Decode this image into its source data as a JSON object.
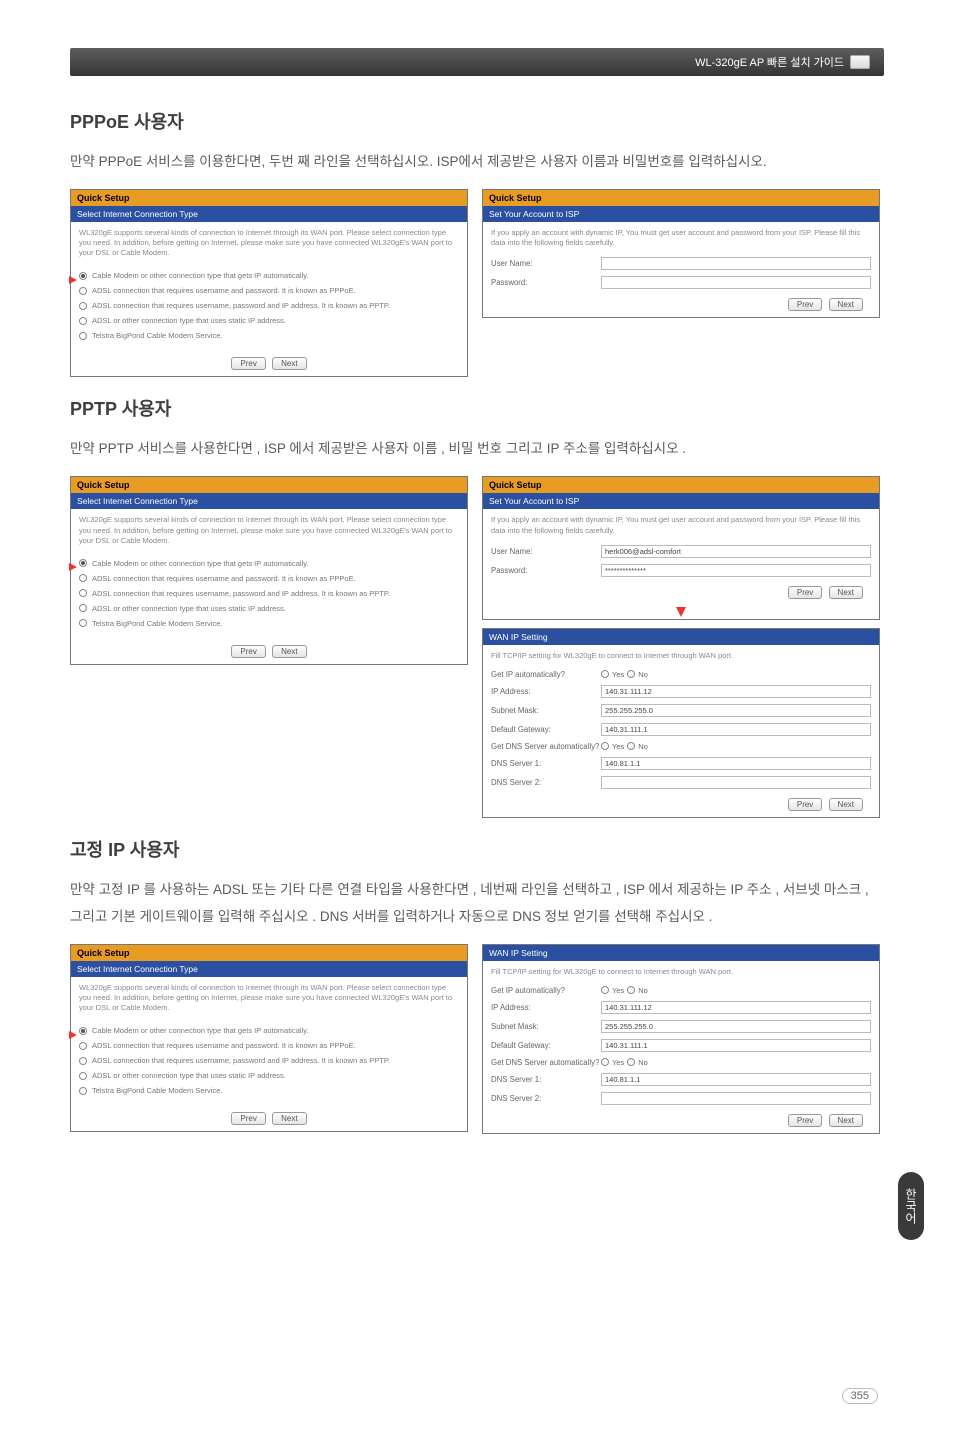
{
  "header": {
    "product": "WL-320gE AP 빠른 설치 가이드"
  },
  "section1": {
    "title": "PPPoE 사용자",
    "body": "만약 PPPoE 서비스를 이용한다면, 두번 째 라인을 선택하십시오. ISP에서 제공받은 사용자 이름과 비밀번호를 입력하십시오."
  },
  "section2": {
    "title": "PPTP 사용자",
    "body": "만약 PPTP 서비스를 사용한다면 , ISP 에서 제공받은 사용자 이름 , 비밀 번호 그리고 IP 주소를 입력하십시오 ."
  },
  "section3": {
    "title": "고정 IP 사용자",
    "body": "만약 고정 IP 를 사용하는 ADSL 또는 기타 다른 연결 타입을 사용한다면 , 네번째 라인을 선택하고 , ISP 에서 제공하는 IP 주소 , 서브넷 마스크 , 그리고 기본 게이트웨이를 입력해 주십시오 . DNS 서버를 입력하거나 자동으로 DNS 정보 얻기를 선택해 주십시오 ."
  },
  "quick_setup": {
    "title": "Quick Setup",
    "blue": "Select Internet Connection Type",
    "intro": "WL320gE supports several kinds of connection to Internet through its WAN port. Please select connection type you need. In addition, before getting on Internet, please make sure you have connected WL320gE's WAN port to your DSL or Cable Modem.",
    "r1": "Cable Modem or other connection type that gets IP automatically.",
    "r2": "ADSL connection that requires username and password. It is known as PPPoE.",
    "r3": "ADSL connection that requires username, password and IP address. It is known as PPTP.",
    "r4": "ADSL or other connection type that uses static IP address.",
    "r5": "Telstra BigPond Cable Modem Service.",
    "prev": "Prev",
    "next": "Next"
  },
  "isp_panel": {
    "title": "Quick Setup",
    "blue": "Set Your Account to ISP",
    "intro": "If you apply an account with dynamic IP, You must get user account and password from your ISP. Please fill this data into the following fields carefully.",
    "user_label": "User Name:",
    "pass_label": "Password:",
    "user_value": "herk006@adsl-comfort",
    "pass_value": "**************"
  },
  "wan_ip": {
    "title": "WAN IP Setting",
    "intro": "Fill TCP/IP setting for WL320gE to connect to Internet through WAN port.",
    "row1": "Get IP automatically?",
    "row2": "IP Address:",
    "row3": "Subnet Mask:",
    "row4": "Default Gateway:",
    "row5": "Get DNS Server automatically?",
    "row6": "DNS Server 1:",
    "row7": "DNS Server 2:",
    "yes": "Yes",
    "no": "No",
    "v_ip": "140.31.111.12",
    "v_mask": "255.255.255.0",
    "v_gw": "140.31.111.1",
    "v_dns1": "140.81.1.1"
  },
  "sideTab": "한국어",
  "pageNumber": "355"
}
